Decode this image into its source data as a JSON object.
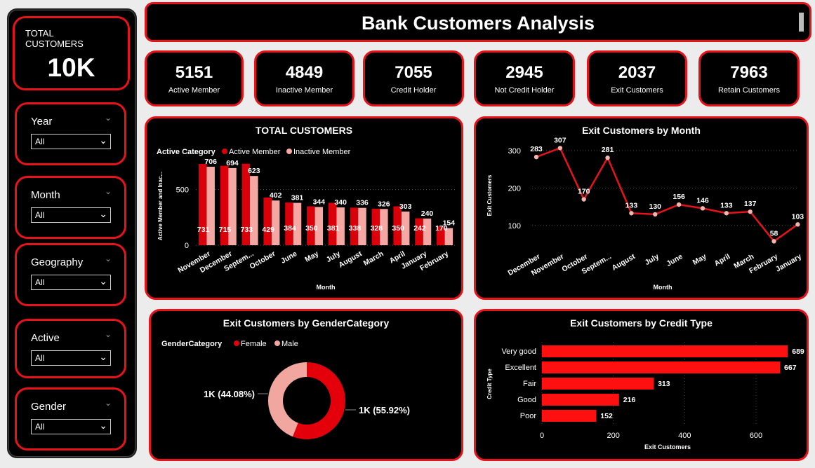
{
  "header": {
    "title": "Bank Customers Analysis"
  },
  "sidebar": {
    "total_label": "TOTAL CUSTOMERS",
    "total_value": "10K",
    "slicers": [
      {
        "title": "Year",
        "value": "All"
      },
      {
        "title": "Month",
        "value": "All"
      },
      {
        "title": "Geography",
        "value": "All"
      },
      {
        "title": "Active",
        "value": "All"
      },
      {
        "title": "Gender",
        "value": "All"
      }
    ]
  },
  "kpis": [
    {
      "value": "5151",
      "label": "Active Member"
    },
    {
      "value": "4849",
      "label": "Inactive Member"
    },
    {
      "value": "7055",
      "label": "Credit Holder"
    },
    {
      "value": "2945",
      "label": "Not Credit Holder"
    },
    {
      "value": "2037",
      "label": "Exit Customers"
    },
    {
      "value": "7963",
      "label": "Retain Customers"
    }
  ],
  "colors": {
    "accent": "#e8121a",
    "active": "#d9000a",
    "inactive": "#f5a8a3",
    "female": "#e3000b",
    "male": "#f2a6a0",
    "bar": "#ff1010",
    "line": "#e8121a"
  },
  "chart_data": [
    {
      "type": "bar",
      "title": "TOTAL CUSTOMERS",
      "legend_title": "Active Category",
      "xlabel": "Month",
      "ylabel": "Active Member and Inac...",
      "ylim": [
        0,
        750
      ],
      "yticks": [
        0,
        500
      ],
      "categories": [
        "November",
        "December",
        "Septem...",
        "October",
        "June",
        "May",
        "July",
        "August",
        "March",
        "April",
        "January",
        "February"
      ],
      "series": [
        {
          "name": "Active Member",
          "values": [
            731,
            715,
            733,
            429,
            384,
            350,
            381,
            338,
            328,
            350,
            242,
            170
          ]
        },
        {
          "name": "Inactive Member",
          "values": [
            706,
            694,
            623,
            402,
            381,
            344,
            340,
            336,
            326,
            303,
            240,
            154
          ]
        }
      ]
    },
    {
      "type": "line",
      "title": "Exit Customers by Month",
      "xlabel": "Month",
      "ylabel": "Exit Customers",
      "ylim": [
        40,
        330
      ],
      "yticks": [
        100,
        200,
        300
      ],
      "categories": [
        "December",
        "November",
        "October",
        "Septem...",
        "August",
        "July",
        "June",
        "May",
        "April",
        "March",
        "February",
        "January"
      ],
      "values": [
        283,
        307,
        170,
        281,
        133,
        130,
        156,
        146,
        133,
        137,
        58,
        103
      ]
    },
    {
      "type": "pie",
      "title": "Exit Customers by GenderCategory",
      "legend_title": "GenderCategory",
      "labels": [
        "Female",
        "Male"
      ],
      "values": [
        55.92,
        44.08
      ],
      "data_labels": [
        "1K (55.92%)",
        "1K (44.08%)"
      ]
    },
    {
      "type": "bar",
      "orientation": "horizontal",
      "title": "Exit Customers by Credit Type",
      "xlabel": "Exit Customers",
      "ylabel": "Credit Type",
      "xlim": [
        0,
        720
      ],
      "xticks": [
        0,
        200,
        400,
        600
      ],
      "categories": [
        "Very good",
        "Excellent",
        "Fair",
        "Good",
        "Poor"
      ],
      "values": [
        689,
        667,
        313,
        216,
        152
      ]
    }
  ]
}
